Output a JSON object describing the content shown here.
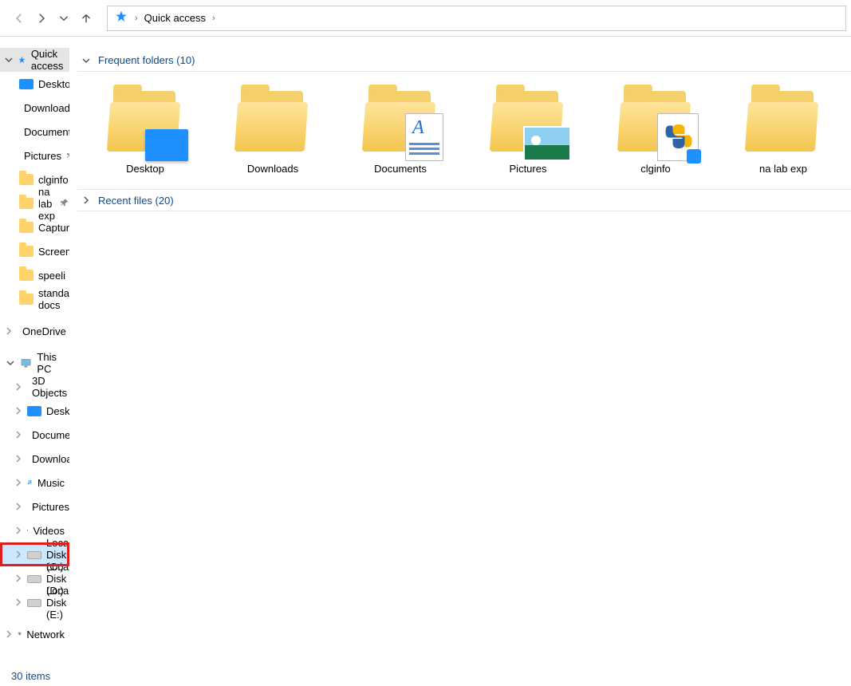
{
  "breadcrumb": {
    "root": "Quick access"
  },
  "tree": {
    "quick_access_header": "Quick access",
    "quick_access": [
      {
        "label": "Desktop",
        "icon": "desktop",
        "pinned": true
      },
      {
        "label": "Downloads",
        "icon": "download",
        "pinned": true
      },
      {
        "label": "Documents",
        "icon": "doc",
        "pinned": true
      },
      {
        "label": "Pictures",
        "icon": "pic",
        "pinned": true
      },
      {
        "label": "clginfo",
        "icon": "folder",
        "pinned": true
      },
      {
        "label": "na lab exp",
        "icon": "folder",
        "pinned": true
      },
      {
        "label": "Captures",
        "icon": "folder",
        "pinned": false
      },
      {
        "label": "Screenshots",
        "icon": "folder",
        "pinned": false
      },
      {
        "label": "speeli",
        "icon": "folder",
        "pinned": false
      },
      {
        "label": "standard docs",
        "icon": "folder",
        "pinned": false
      }
    ],
    "onedrive": "OneDrive",
    "thispc_header": "This PC",
    "thispc": [
      {
        "label": "3D Objects",
        "icon": "3d"
      },
      {
        "label": "Desktop",
        "icon": "desktop"
      },
      {
        "label": "Documents",
        "icon": "doc"
      },
      {
        "label": "Downloads",
        "icon": "download"
      },
      {
        "label": "Music",
        "icon": "music"
      },
      {
        "label": "Pictures",
        "icon": "pic"
      },
      {
        "label": "Videos",
        "icon": "video"
      },
      {
        "label": "Local Disk (C:)",
        "icon": "drive",
        "highlight": true
      },
      {
        "label": "Local Disk (D:)",
        "icon": "drive"
      },
      {
        "label": "Local Disk (E:)",
        "icon": "drive"
      }
    ],
    "network": "Network"
  },
  "sections": {
    "frequent": {
      "title": "Frequent folders (10)"
    },
    "recent": {
      "title": "Recent files (20)"
    }
  },
  "frequent_folders": [
    {
      "label": "Desktop",
      "overlay": "desktop"
    },
    {
      "label": "Downloads",
      "overlay": "download"
    },
    {
      "label": "Documents",
      "overlay": "doc"
    },
    {
      "label": "Pictures",
      "overlay": "pic"
    },
    {
      "label": "clginfo",
      "overlay": "py"
    },
    {
      "label": "na lab exp",
      "overlay": "none"
    }
  ],
  "statusbar": {
    "item_count": "30 items"
  }
}
